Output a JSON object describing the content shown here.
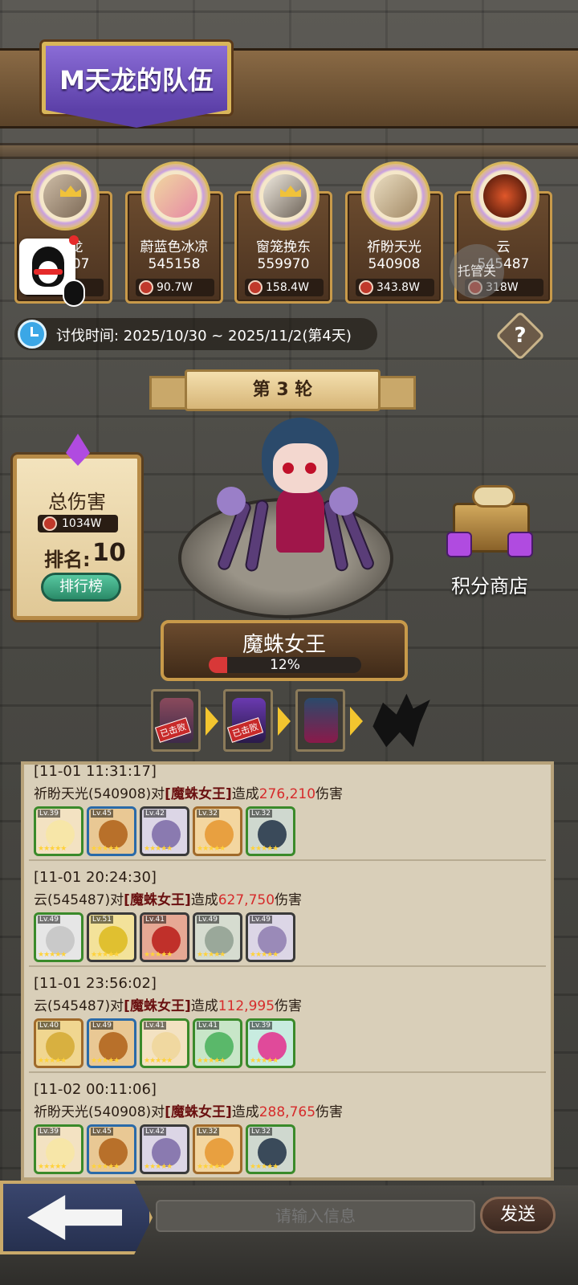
{
  "header": {
    "title": "M天龙的队伍"
  },
  "members": [
    {
      "name": "M天龙",
      "power": "545407",
      "damage": ""
    },
    {
      "name": "蔚蓝色冰凉",
      "power": "545158",
      "damage": "90.7W"
    },
    {
      "name": "窗笼挽东",
      "power": "559970",
      "damage": "158.4W"
    },
    {
      "name": "祈盼天光",
      "power": "540908",
      "damage": "343.8W"
    },
    {
      "name": "云",
      "power": "545487",
      "damage": "318W"
    }
  ],
  "overlay": {
    "tuoguan": "托管关"
  },
  "event": {
    "time_text": "讨伐时间: 2025/10/30 ~ 2025/11/2(第4天)",
    "help": "?"
  },
  "round": {
    "label": "第 3 轮"
  },
  "damage_panel": {
    "title": "总伤害",
    "total": "1034W",
    "rank_label": "排名:",
    "rank_value": "10",
    "leaderboard_button": "排行榜"
  },
  "shop": {
    "label": "积分商店"
  },
  "boss": {
    "name": "魔蛛女王",
    "hp_text": "12%",
    "hp_fraction": 0.12
  },
  "stages": [
    {
      "status": "已击败"
    },
    {
      "status": "已击败"
    },
    {
      "status": ""
    },
    {
      "status": ""
    }
  ],
  "logs": [
    {
      "time": "[11-01 11:31:17]",
      "attacker": "祈盼天光(540908)对",
      "boss": "[魔蛛女王]",
      "verb": "造成",
      "damage": "276,210",
      "suffix": "伤害",
      "heroes": [
        {
          "lv": "Lv.39"
        },
        {
          "lv": "Lv.45"
        },
        {
          "lv": "Lv.42"
        },
        {
          "lv": "Lv.32"
        },
        {
          "lv": "Lv.32"
        }
      ]
    },
    {
      "time": "[11-01 20:24:30]",
      "attacker": "云(545487)对",
      "boss": "[魔蛛女王]",
      "verb": "造成",
      "damage": "627,750",
      "suffix": "伤害",
      "heroes": [
        {
          "lv": "Lv.49"
        },
        {
          "lv": "Lv.51"
        },
        {
          "lv": "Lv.41"
        },
        {
          "lv": "Lv.49"
        },
        {
          "lv": "Lv.49"
        }
      ]
    },
    {
      "time": "[11-01 23:56:02]",
      "attacker": "云(545487)对",
      "boss": "[魔蛛女王]",
      "verb": "造成",
      "damage": "112,995",
      "suffix": "伤害",
      "heroes": [
        {
          "lv": "Lv.40"
        },
        {
          "lv": "Lv.49"
        },
        {
          "lv": "Lv.41"
        },
        {
          "lv": "Lv.41"
        },
        {
          "lv": "Lv.39"
        }
      ]
    },
    {
      "time": "[11-02 00:11:06]",
      "attacker": "祈盼天光(540908)对",
      "boss": "[魔蛛女王]",
      "verb": "造成",
      "damage": "288,765",
      "suffix": "伤害",
      "heroes": [
        {
          "lv": "Lv.39"
        },
        {
          "lv": "Lv.45"
        },
        {
          "lv": "Lv.42"
        },
        {
          "lv": "Lv.32"
        },
        {
          "lv": "Lv.32"
        }
      ]
    }
  ],
  "input": {
    "placeholder": "请输入信息",
    "send": "发送"
  },
  "colors": {
    "accent_purple": "#6c4fc0",
    "frame_gold": "#c89a4a",
    "damage_red": "#d62b2b",
    "hp_red": "#d83838"
  }
}
